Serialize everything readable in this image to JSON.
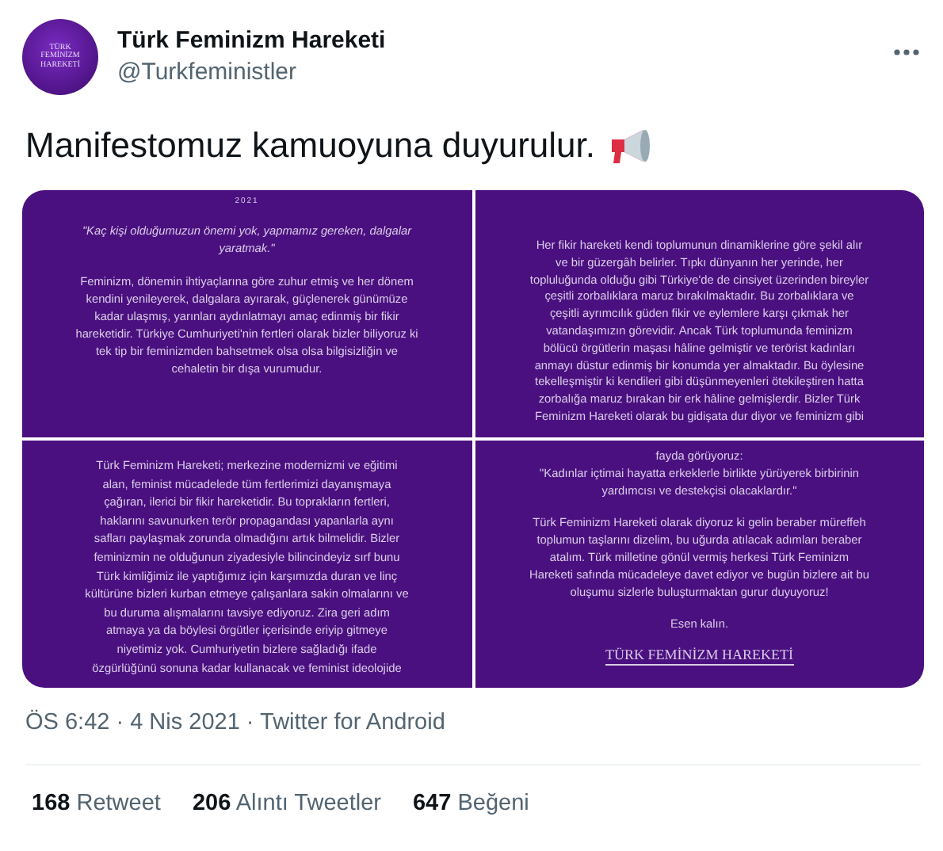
{
  "author": {
    "avatar_text": [
      "TÜRK",
      "FEMİNİZM",
      "HAREKETİ"
    ],
    "name": "Türk Feminizm Hareketi",
    "handle": "@Turkfeministler"
  },
  "tweet_text": "Manifestomuz kamuoyuna duyurulur.",
  "images": [
    {
      "paragraphs": [
        {
          "kind": "date",
          "lines": [
            "2021"
          ]
        },
        {
          "kind": "quote",
          "lines": [
            "\"Kaç kişi olduğumuzun önemi yok, yapmamız gereken, dalgalar",
            "yaratmak.\""
          ]
        },
        {
          "kind": "body",
          "lines": [
            "Feminizm, dönemin ihtiyaçlarına göre zuhur etmiş ve her dönem",
            "kendini yenileyerek, dalgalara ayırarak, güçlenerek günümüze",
            "kadar ulaşmış, yarınları aydınlatmayı amaç edinmiş bir fikir",
            "hareketidir. Türkiye Cumhuriyeti'nin fertleri olarak bizler biliyoruz ki",
            "tek tip bir feminizmden bahsetmek olsa olsa bilgisizliğin ve",
            "cehaletin bir dışa vurumudur."
          ]
        }
      ]
    },
    {
      "paragraphs": [
        {
          "kind": "body",
          "lines": [
            "Her fikir hareketi kendi toplumunun dinamiklerine göre şekil alır",
            "ve bir güzergâh belirler. Tıpkı dünyanın her yerinde, her",
            "topluluğunda olduğu gibi Türkiye'de de cinsiyet üzerinden bireyler",
            "çeşitli zorbalıklara maruz bırakılmaktadır. Bu zorbalıklara ve",
            "çeşitli ayrımcılık güden fikir ve eylemlere karşı çıkmak her",
            "vatandaşımızın görevidir. Ancak Türk toplumunda feminizm",
            "bölücü örgütlerin maşası hâline gelmiştir ve terörist kadınları",
            "anmayı düstur edinmiş bir konumda yer almaktadır. Bu öylesine",
            "tekelleşmiştir ki kendileri gibi düşünmeyenleri ötekileştiren hatta",
            "zorbalığa maruz bırakan bir erk hâline gelmişlerdir. Bizler Türk",
            "Feminizm Hareketi olarak bu gidişata dur diyor ve feminizm gibi"
          ]
        }
      ]
    },
    {
      "paragraphs": [
        {
          "kind": "body",
          "lines": [
            "Türk Feminizm Hareketi; merkezine modernizmi ve eğitimi",
            "alan, feminist mücadelede tüm fertlerimizi dayanışmaya",
            "çağıran, ilerici bir fikir hareketidir. Bu toprakların fertleri,",
            "haklarını savunurken terör propagandası yapanlarla aynı",
            "safları paylaşmak zorunda olmadığını artık bilmelidir. Bizler",
            "feminizmin ne olduğunun ziyadesiyle bilincindeyiz sırf bunu",
            "Türk kimliğimiz ile yaptığımız için karşımızda duran ve linç",
            "kültürüne bizleri kurban etmeye çalışanlara sakin olmalarını ve",
            "bu duruma alışmalarını tavsiye ediyoruz. Zira geri adım",
            "atmaya ya da böylesi örgütler içerisinde eriyip gitmeye",
            "niyetimiz yok. Cumhuriyetin bizlere sağladığı ifade",
            "özgürlüğünü sonuna kadar kullanacak ve feminist ideolojide"
          ]
        }
      ]
    },
    {
      "paragraphs": [
        {
          "kind": "body",
          "lines": [
            "fayda görüyoruz:",
            "\"Kadınlar içtimai hayatta erkeklerle birlikte yürüyerek birbirinin",
            "yardımcısı ve destekçisi olacaklardır.\""
          ]
        },
        {
          "kind": "body",
          "lines": [
            "Türk Feminizm Hareketi olarak diyoruz ki gelin beraber müreffeh",
            "toplumun taşlarını dizelim, bu uğurda atılacak adımları beraber",
            "atalım. Türk milletine gönül vermiş herkesi Türk Feminizm",
            "Hareketi safında mücadeleye davet ediyor ve bugün bizlere ait bu",
            "oluşumu sizlerle buluşturmaktan gurur duyuyoruz!"
          ]
        },
        {
          "kind": "body",
          "lines": [
            "Esen kalın."
          ]
        },
        {
          "kind": "signature",
          "lines": [
            "TÜRK FEMİNİZM HAREKETİ"
          ]
        }
      ]
    }
  ],
  "meta": "ÖS 6:42 · 4 Nis 2021 · Twitter for Android",
  "stats": [
    {
      "count": "168",
      "label": "Retweet"
    },
    {
      "count": "206",
      "label": "Alıntı Tweetler"
    },
    {
      "count": "647",
      "label": "Beğeni"
    }
  ]
}
